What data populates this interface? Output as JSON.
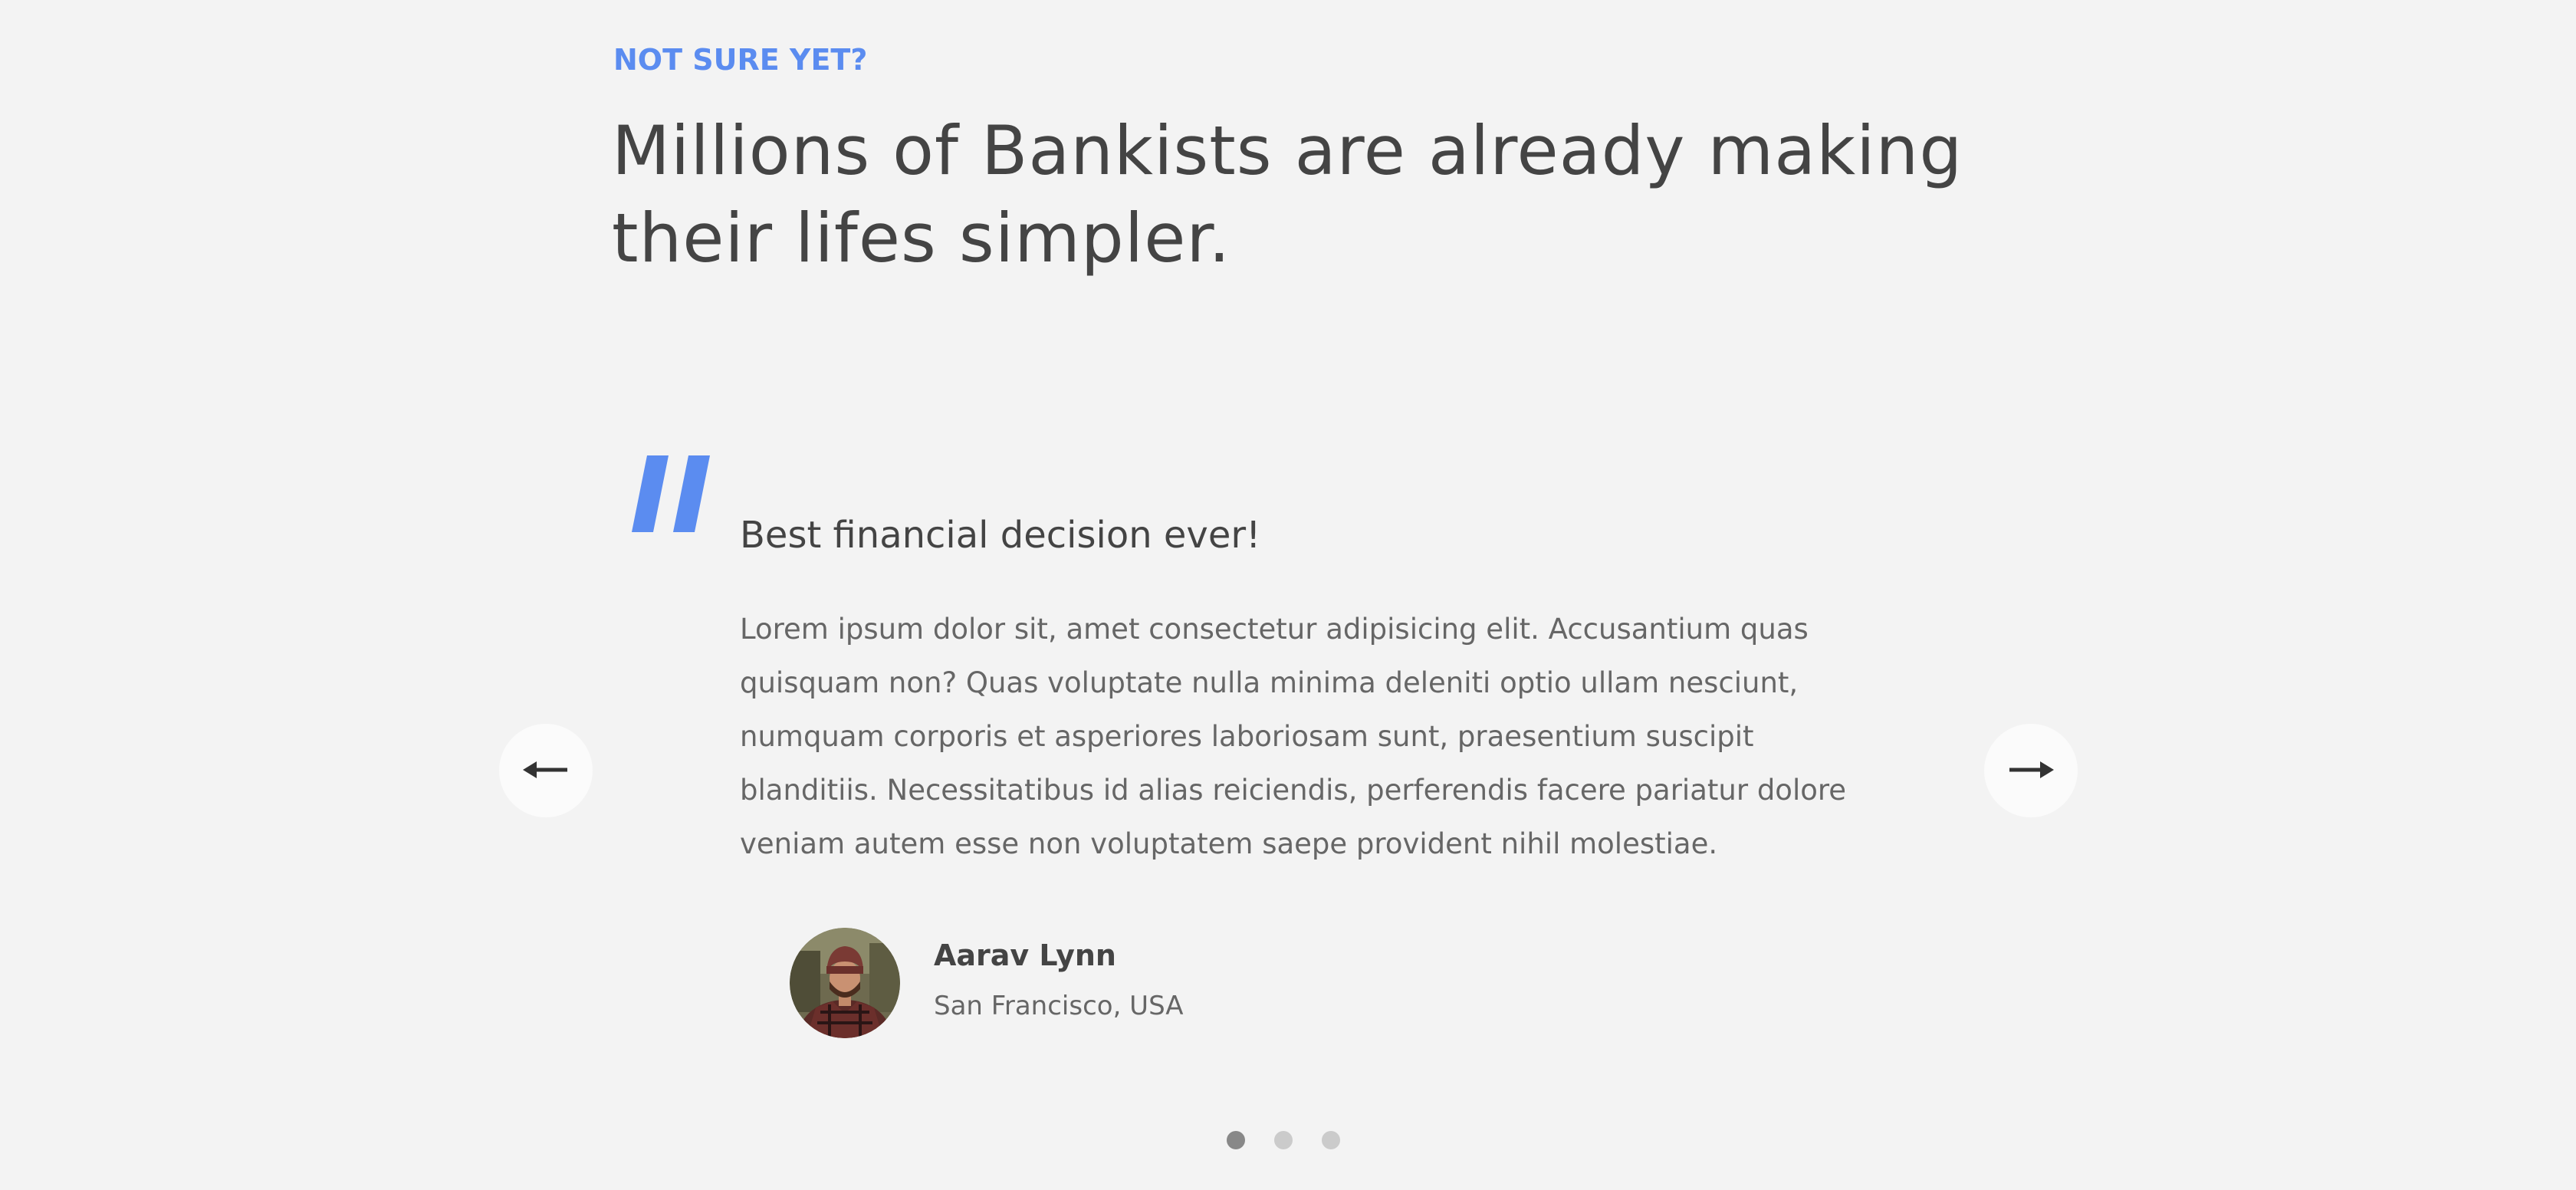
{
  "section": {
    "label": "NOT SURE YET?",
    "title": "Millions of Bankists are already making their lifes simpler."
  },
  "testimonial": {
    "header": "Best financial decision ever!",
    "text": "Lorem ipsum dolor sit, amet consectetur adipisicing elit. Accusantium quas quisquam non? Quas voluptate nulla minima deleniti optio ullam nesciunt, numquam corporis et asperiores laboriosam sunt, praesentium suscipit blanditiis. Necessitatibus id alias reiciendis, perferendis facere pariatur dolore veniam autem esse non voluptatem saepe provident nihil molestiae.",
    "author_name": "Aarav Lynn",
    "author_location": "San Francisco, USA"
  },
  "icons": {
    "quote": "quote-icon",
    "left": "arrow-left-icon",
    "right": "arrow-right-icon"
  },
  "colors": {
    "accent": "#5b8cf0",
    "background": "#f3f3f3",
    "heading": "#444444",
    "body_text": "#666666"
  },
  "slider": {
    "total_slides": 3,
    "active_slide": 1
  }
}
